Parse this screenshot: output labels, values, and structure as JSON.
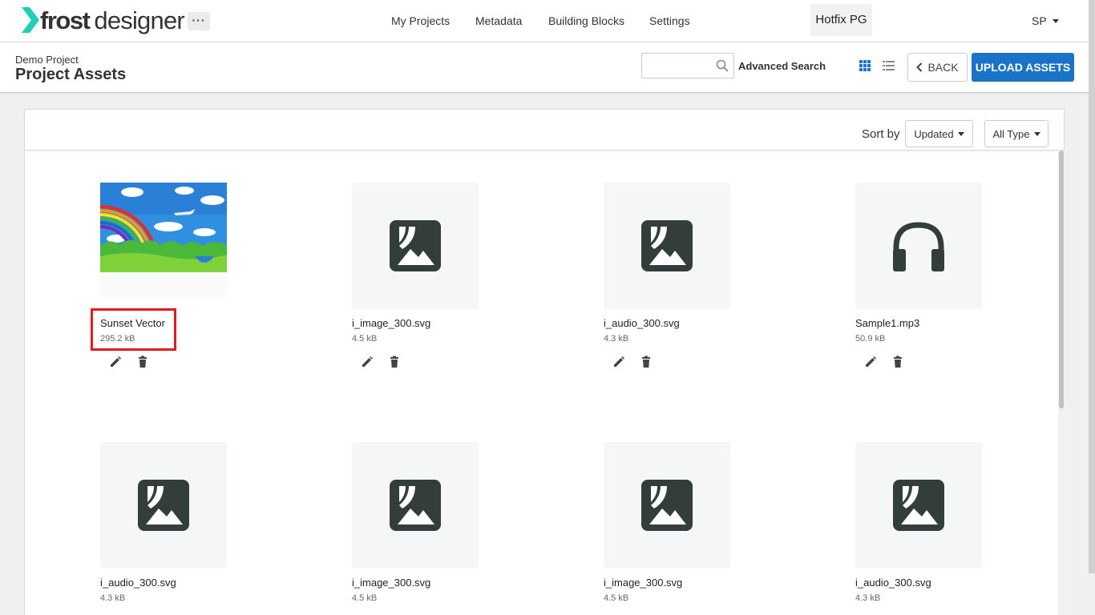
{
  "app": {
    "logo_frost": "frost",
    "logo_designer": "designer",
    "more_label": "···",
    "nav": [
      "My Projects",
      "Metadata",
      "Building Blocks",
      "Settings"
    ],
    "workspace": "Hotfix PG",
    "user_initials": "SP"
  },
  "header": {
    "breadcrumb": "Demo Project",
    "title": "Project Assets",
    "search_placeholder": "",
    "advanced_search": "Advanced Search",
    "back_label": "BACK",
    "upload_label": "UPLOAD ASSETS"
  },
  "toolbar": {
    "sort_label": "Sort by",
    "sort_value": "Updated",
    "type_value": "All Type"
  },
  "colors": {
    "accent": "#1a73c7",
    "icon_dark": "#333d3c",
    "logo_cyan": "#1fd1b4",
    "highlight": "#e31b1b"
  },
  "assets": [
    {
      "name": "Sunset Vector",
      "size": "295.2 kB",
      "icon": "photo-thumbnail",
      "highlighted": true
    },
    {
      "name": "i_image_300.svg",
      "size": "4.5 kB",
      "icon": "image-icon"
    },
    {
      "name": "i_audio_300.svg",
      "size": "4.3 kB",
      "icon": "image-icon"
    },
    {
      "name": "Sample1.mp3",
      "size": "50.9 kB",
      "icon": "headphones-icon"
    },
    {
      "name": "i_audio_300.svg",
      "size": "4.3 kB",
      "icon": "image-icon"
    },
    {
      "name": "i_image_300.svg",
      "size": "4.5 kB",
      "icon": "image-icon"
    },
    {
      "name": "i_image_300.svg",
      "size": "4.5 kB",
      "icon": "image-icon"
    },
    {
      "name": "i_audio_300.svg",
      "size": "4.3 kB",
      "icon": "image-icon"
    }
  ]
}
